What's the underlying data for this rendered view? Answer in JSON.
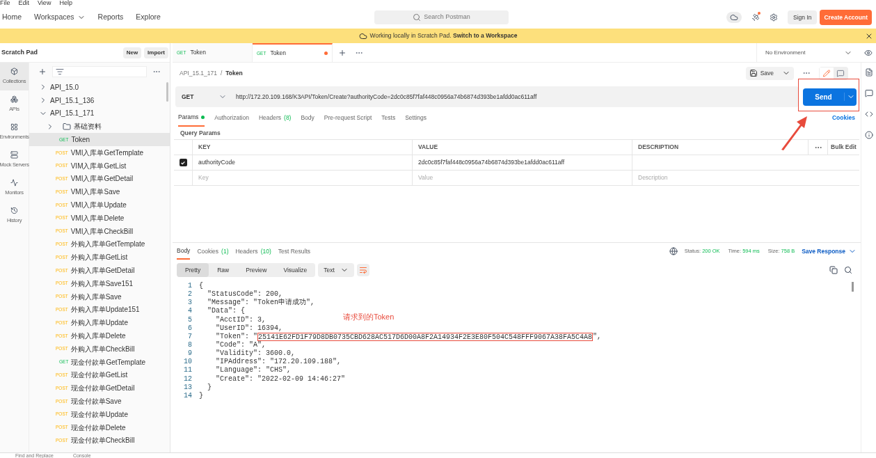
{
  "menu_bar": [
    "File",
    "Edit",
    "View",
    "Help"
  ],
  "nav": {
    "items": [
      {
        "label": "Home",
        "dropdown": false
      },
      {
        "label": "Workspaces",
        "dropdown": true
      },
      {
        "label": "Reports",
        "dropdown": false
      },
      {
        "label": "Explore",
        "dropdown": false
      }
    ],
    "search_placeholder": "Search Postman",
    "sign_in": "Sign In",
    "create_account": "Create Account"
  },
  "banner": {
    "text": "Working locally in Scratch Pad.",
    "link": "Switch to a Workspace"
  },
  "sidebar": {
    "title": "Scratch Pad",
    "buttons": [
      "New",
      "Import"
    ],
    "rail": [
      {
        "kind": "collections",
        "label": "Collections",
        "selected": true
      },
      {
        "kind": "apis",
        "label": "APIs",
        "selected": false
      },
      {
        "kind": "environments",
        "label": "Environments",
        "selected": false
      },
      {
        "kind": "mock",
        "label": "Mock Servers",
        "selected": false
      },
      {
        "kind": "monitors",
        "label": "Monitors",
        "selected": false
      },
      {
        "kind": "history",
        "label": "History",
        "selected": false
      }
    ],
    "tree": [
      {
        "kind": "collection",
        "label": "API_15.0",
        "expanded": false
      },
      {
        "kind": "collection",
        "label": "API_15.1_136",
        "expanded": false
      },
      {
        "kind": "collection",
        "label": "API_15.1_171",
        "expanded": true,
        "children": [
          {
            "kind": "folder",
            "label": "基础资料",
            "expanded": false
          },
          {
            "kind": "request",
            "method": "GET",
            "label": "Token",
            "selected": true
          },
          {
            "kind": "request",
            "method": "POST",
            "label": "VMI入库单GetTemplate",
            "selected": false
          },
          {
            "kind": "request",
            "method": "POST",
            "label": "VIM入库单GetList",
            "selected": false
          },
          {
            "kind": "request",
            "method": "POST",
            "label": "VMI入库单GetDetail",
            "selected": false
          },
          {
            "kind": "request",
            "method": "POST",
            "label": "VMI入库单Save",
            "selected": false
          },
          {
            "kind": "request",
            "method": "POST",
            "label": "VMI入库单Update",
            "selected": false
          },
          {
            "kind": "request",
            "method": "POST",
            "label": "VMI入库单Delete",
            "selected": false
          },
          {
            "kind": "request",
            "method": "POST",
            "label": "VMI入库单CheckBill",
            "selected": false
          },
          {
            "kind": "request",
            "method": "POST",
            "label": "外购入库单GetTemplate",
            "selected": false
          },
          {
            "kind": "request",
            "method": "POST",
            "label": "外购入库单GetList",
            "selected": false
          },
          {
            "kind": "request",
            "method": "POST",
            "label": "外购入库单GetDetail",
            "selected": false
          },
          {
            "kind": "request",
            "method": "POST",
            "label": "外购入库单Save151",
            "selected": false
          },
          {
            "kind": "request",
            "method": "POST",
            "label": "外购入库单Save",
            "selected": false
          },
          {
            "kind": "request",
            "method": "POST",
            "label": "外购入库单Update151",
            "selected": false
          },
          {
            "kind": "request",
            "method": "POST",
            "label": "外购入库单Update",
            "selected": false
          },
          {
            "kind": "request",
            "method": "POST",
            "label": "外购入库单Delete",
            "selected": false
          },
          {
            "kind": "request",
            "method": "POST",
            "label": "外购入库单CheckBill",
            "selected": false
          },
          {
            "kind": "request",
            "method": "GET",
            "label": "现金付款单GetTemplate",
            "selected": false
          },
          {
            "kind": "request",
            "method": "POST",
            "label": "现金付款单GetList",
            "selected": false
          },
          {
            "kind": "request",
            "method": "POST",
            "label": "现金付款单GetDetail",
            "selected": false
          },
          {
            "kind": "request",
            "method": "POST",
            "label": "现金付款单Save",
            "selected": false
          },
          {
            "kind": "request",
            "method": "POST",
            "label": "现金付款单Update",
            "selected": false
          },
          {
            "kind": "request",
            "method": "POST",
            "label": "现金付款单Delete",
            "selected": false
          },
          {
            "kind": "request",
            "method": "POST",
            "label": "现金付款单CheckBill",
            "selected": false
          }
        ]
      }
    ]
  },
  "tabs": [
    {
      "method": "GET",
      "label": "Token",
      "selected": false,
      "unsaved": false
    },
    {
      "method": "GET",
      "label": "Token",
      "selected": true,
      "unsaved": true
    }
  ],
  "environment": "No Environment",
  "request": {
    "breadcrumb": [
      "API_15.1_171",
      "/",
      "Token"
    ],
    "save": "Save",
    "method": "GET",
    "url": "http://172.20.109.168/K3API/Token/Create?authorityCode=2dc0c85f7faf448c0956a74b6874d393be1afdd0ac611aff",
    "send": "Send",
    "tabs": [
      {
        "label": "Params",
        "active_dot": true,
        "selected": true
      },
      {
        "label": "Authorization",
        "active_dot": false,
        "selected": false
      },
      {
        "label": "Headers",
        "count": "(8)",
        "active_dot": false,
        "selected": false
      },
      {
        "label": "Body",
        "active_dot": false,
        "selected": false
      },
      {
        "label": "Pre-request Script",
        "active_dot": false,
        "selected": false
      },
      {
        "label": "Tests",
        "active_dot": false,
        "selected": false
      },
      {
        "label": "Settings",
        "active_dot": false,
        "selected": false
      }
    ],
    "cookies": "Cookies",
    "section_title": "Query Params",
    "columns": [
      "KEY",
      "VALUE",
      "DESCRIPTION"
    ],
    "bulk_edit": "Bulk Edit",
    "rows": [
      {
        "key": "authorityCode",
        "value": "2dc0c85f7faf448c0956a74b6874d393be1afdd0ac611aff",
        "checked": true
      }
    ],
    "new_row": {
      "key": "Key",
      "value": "Value",
      "description": "Description"
    }
  },
  "response": {
    "tabs": [
      {
        "label": "Body",
        "selected": true
      },
      {
        "label": "Cookies",
        "count": "(1)",
        "selected": false
      },
      {
        "label": "Headers",
        "count": "(10)",
        "selected": false
      },
      {
        "label": "Test Results",
        "selected": false
      }
    ],
    "status_label": "Status:",
    "status": "200 OK",
    "time_label": "Time:",
    "time": "594 ms",
    "size_label": "Size:",
    "size": "758 B",
    "save_response": "Save Response",
    "views": [
      {
        "label": "Pretty",
        "selected": true
      },
      {
        "label": "Raw",
        "selected": false
      },
      {
        "label": "Preview",
        "selected": false
      },
      {
        "label": "Visualize",
        "selected": false
      }
    ],
    "format": "Text",
    "lines": [
      {
        "number": "1",
        "kind": "plain",
        "text": "{"
      },
      {
        "number": "2",
        "kind": "plain",
        "text": "  \"StatusCode\": 200,"
      },
      {
        "number": "3",
        "kind": "plain",
        "text": "  \"Message\": \"Token申请成功\","
      },
      {
        "number": "4",
        "kind": "plain",
        "text": "  \"Data\": {"
      },
      {
        "number": "5",
        "kind": "plain",
        "text": "    \"AcctID\": 3,"
      },
      {
        "number": "6",
        "kind": "plain",
        "text": "    \"UserID\": 16394,"
      },
      {
        "number": "7",
        "kind": "boxed",
        "text": "    \"Token\": \"",
        "boxed": "25141E62FD1F79D8DB0735CBD628AC517D6D00A8F2A14934F2E3E80F504C548FFF9067A38FA5C4A8",
        "suffix": "\","
      },
      {
        "number": "8",
        "kind": "plain",
        "text": "    \"Code\": \"A\","
      },
      {
        "number": "9",
        "kind": "plain",
        "text": "    \"Validity\": 3600.0,"
      },
      {
        "number": "10",
        "kind": "plain",
        "text": "    \"IPAddress\": \"172.20.109.188\","
      },
      {
        "number": "11",
        "kind": "plain",
        "text": "    \"Language\": \"CHS\","
      },
      {
        "number": "12",
        "kind": "plain",
        "text": "    \"Create\": \"2022-02-09 14:46:27\""
      },
      {
        "number": "13",
        "kind": "plain",
        "text": "  }"
      },
      {
        "number": "14",
        "kind": "plain",
        "text": "}"
      }
    ],
    "annotation": "请求到的Token"
  },
  "status_bar": [
    "Find and Replace",
    "Console"
  ]
}
